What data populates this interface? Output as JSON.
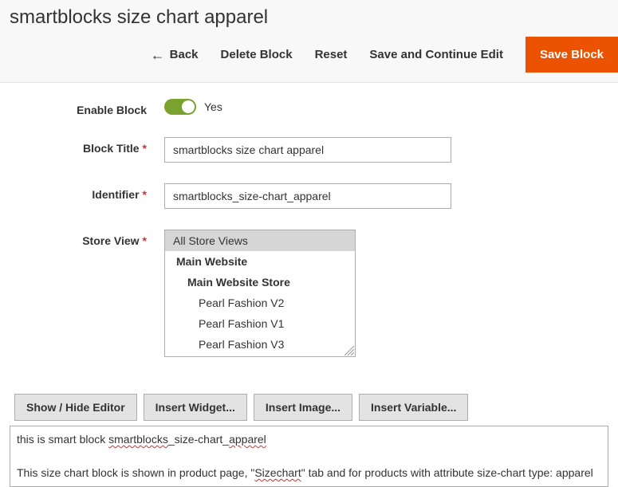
{
  "header": {
    "title": "smartblocks size chart apparel",
    "back_label": "Back",
    "delete_label": "Delete Block",
    "reset_label": "Reset",
    "save_continue_label": "Save and Continue Edit",
    "save_label": "Save Block"
  },
  "form": {
    "enable_block": {
      "label": "Enable Block",
      "value_text": "Yes"
    },
    "block_title": {
      "label": "Block Title",
      "value": "smartblocks size chart apparel"
    },
    "identifier": {
      "label": "Identifier",
      "value": "smartblocks_size-chart_apparel"
    },
    "store_view": {
      "label": "Store View",
      "selected": "All Store Views",
      "group": "Main Website",
      "subgroup": "Main Website Store",
      "items": [
        "Pearl Fashion V2",
        "Pearl Fashion V1",
        "Pearl Fashion V3"
      ]
    }
  },
  "editor": {
    "toolbar": {
      "show_hide": "Show / Hide Editor",
      "insert_widget": "Insert Widget...",
      "insert_image": "Insert Image...",
      "insert_variable": "Insert Variable..."
    },
    "line1_a": "this is smart block ",
    "line1_b": "smartblocks",
    "line1_c": "_size-chart_",
    "line1_d": "apparel",
    "line2_a": "This size chart block is shown in product page, \"",
    "line2_b": "Sizechart",
    "line2_c": "\" tab and for products with attribute size-chart type: apparel"
  }
}
